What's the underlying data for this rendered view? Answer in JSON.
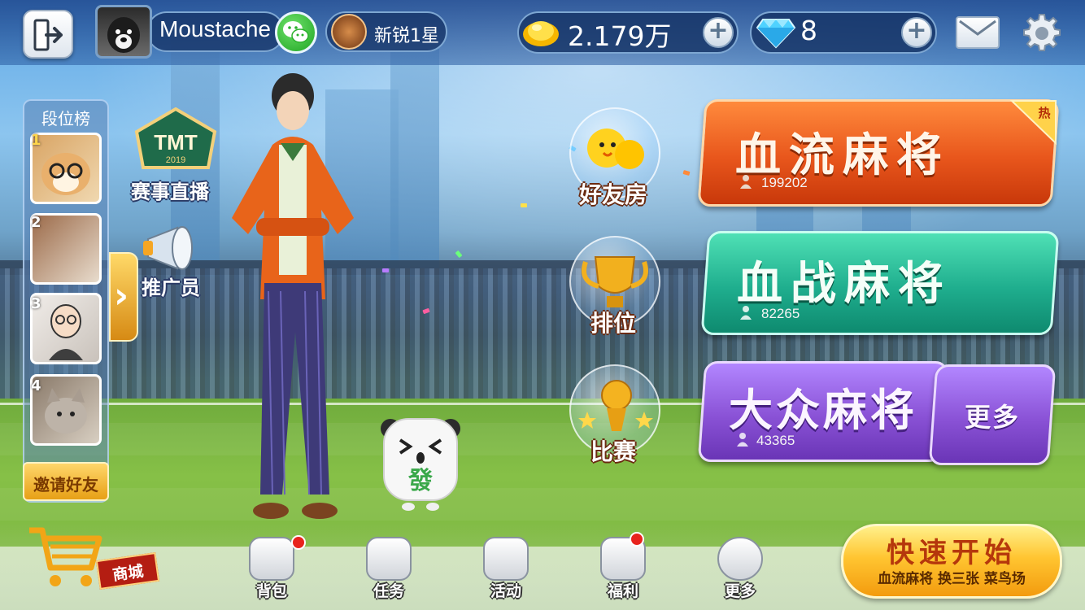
{
  "topbar": {
    "username": "Moustache",
    "rank_label": "新锐1星",
    "coins": "2.179万",
    "gems": "8",
    "add_symbol": "+"
  },
  "rank_panel": {
    "title": "段位榜",
    "entries": [
      {
        "rank": "1"
      },
      {
        "rank": "2"
      },
      {
        "rank": "3"
      },
      {
        "rank": "4"
      }
    ],
    "invite_label": "邀请好友",
    "expand_symbol": "›"
  },
  "features": {
    "live_label": "赛事直播",
    "tmt_text": "TMT",
    "tmt_year": "2019",
    "promoter_label": "推广员"
  },
  "mascot": {
    "tile_char": "發"
  },
  "bubbles": {
    "friends_room": "好友房",
    "ranked": "排位",
    "match": "比赛"
  },
  "modes": {
    "xueliu": {
      "title": "血流麻将",
      "count": "199202",
      "hot": "热"
    },
    "xuezhan": {
      "title": "血战麻将",
      "count": "82265"
    },
    "dazhong": {
      "title": "大众麻将",
      "count": "43365"
    },
    "more": "更多"
  },
  "bottom_nav": {
    "shop": "商城",
    "bag": "背包",
    "tasks": "任务",
    "events": "活动",
    "welfare": "福利",
    "more": "更多"
  },
  "quick_start": {
    "title": "快速开始",
    "subtitle": "血流麻将 换三张 菜鸟场"
  },
  "colors": {
    "xueliu": "#e8561c",
    "xuezhan": "#1fae8e",
    "dazhong": "#8a52d6"
  }
}
